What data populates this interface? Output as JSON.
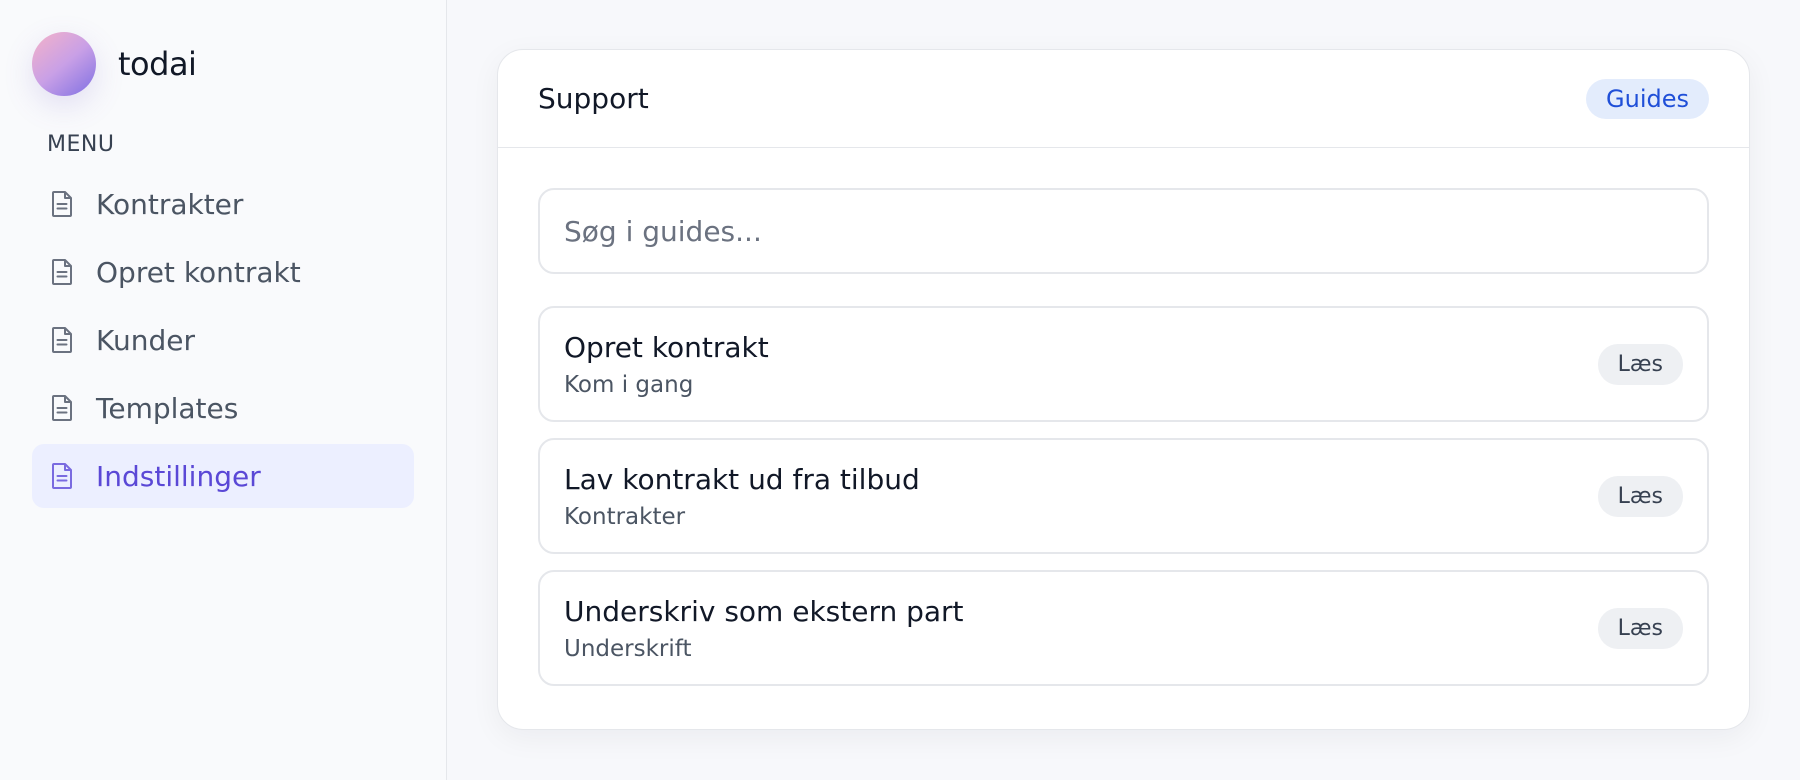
{
  "brand": {
    "name": "todai",
    "logo_icon": "gradient-orb-logo"
  },
  "sidebar": {
    "menu_label": "MENU",
    "items": [
      {
        "label": "Kontrakter",
        "icon": "document-icon",
        "active": false
      },
      {
        "label": "Opret kontrakt",
        "icon": "document-icon",
        "active": false
      },
      {
        "label": "Kunder",
        "icon": "document-icon",
        "active": false
      },
      {
        "label": "Templates",
        "icon": "document-icon",
        "active": false
      },
      {
        "label": "Indstillinger",
        "icon": "document-icon",
        "active": true
      }
    ]
  },
  "support": {
    "title": "Support",
    "badge": "Guides",
    "search_placeholder": "Søg i guides...",
    "guides": [
      {
        "title": "Opret kontrakt",
        "subtitle": "Kom i gang",
        "button": "Læs"
      },
      {
        "title": "Lav kontrakt ud fra tilbud",
        "subtitle": "Kontrakter",
        "button": "Læs"
      },
      {
        "title": "Underskriv som ekstern part",
        "subtitle": "Underskrift",
        "button": "Læs"
      }
    ]
  },
  "colors": {
    "accent": "#5a48d6",
    "active_bg": "#ecefff",
    "badge_bg": "#e3ecfc",
    "badge_text": "#1f4fd8"
  }
}
